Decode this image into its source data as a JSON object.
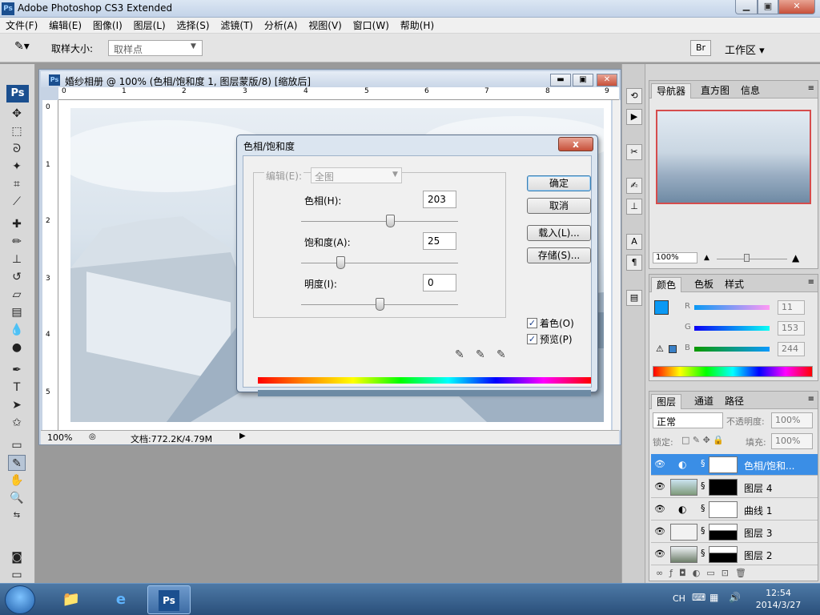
{
  "window": {
    "title": "Adobe Photoshop CS3 Extended",
    "app_icon": "Ps"
  },
  "menu": [
    "文件(F)",
    "编辑(E)",
    "图像(I)",
    "图层(L)",
    "选择(S)",
    "滤镜(T)",
    "分析(A)",
    "视图(V)",
    "窗口(W)",
    "帮助(H)"
  ],
  "options": {
    "sample_label": "取样大小:",
    "sample_value": "取样点",
    "workspace": "工作区 ▾",
    "bridge": "Br"
  },
  "toolbox": {
    "logo": "Ps"
  },
  "document": {
    "title": "婚纱相册 @ 100% (色相/饱和度 1, 图层蒙版/8) [缩放后]",
    "ruler_top": [
      "0",
      "1",
      "2",
      "3",
      "4",
      "5",
      "6",
      "7",
      "8",
      "9"
    ],
    "ruler_left": [
      "0",
      "1",
      "2",
      "3",
      "4",
      "5"
    ],
    "zoom": "100%",
    "status": "文档:772.2K/4.79M"
  },
  "dialog": {
    "title": "色相/饱和度",
    "close": "x",
    "edit_label": "编辑(E):",
    "edit_value": "全图",
    "hue_label": "色相(H):",
    "hue_value": "203",
    "sat_label": "饱和度(A):",
    "sat_value": "25",
    "light_label": "明度(I):",
    "light_value": "0",
    "ok": "确定",
    "cancel": "取消",
    "load": "载入(L)...",
    "save": "存储(S)...",
    "colorize": "着色(O)",
    "preview": "预览(P)",
    "colorize_checked": true,
    "preview_checked": true,
    "hue_level": 0.565,
    "sat_level": 0.25,
    "light_level": 0.5
  },
  "navigator": {
    "tabs": [
      "导航器",
      "直方图",
      "信息"
    ],
    "zoom": "100%"
  },
  "color_panel": {
    "tabs": [
      "颜色",
      "色板",
      "样式"
    ],
    "r_label": "R",
    "g_label": "G",
    "b_label": "B",
    "r": "11",
    "g": "153",
    "b": "244",
    "fg_color": "#0b99f4"
  },
  "layers_panel": {
    "tabs": [
      "图层",
      "通道",
      "路径"
    ],
    "blend": "正常",
    "opacity_label": "不透明度:",
    "opacity": "100%",
    "lock_label": "锁定:",
    "fill_label": "填充:",
    "fill": "100%",
    "layers": [
      {
        "name": "色相/饱和...",
        "selected": true
      },
      {
        "name": "图层 4",
        "selected": false
      },
      {
        "name": "曲线 1",
        "selected": false
      },
      {
        "name": "图层 3",
        "selected": false
      },
      {
        "name": "图层 2",
        "selected": false
      }
    ]
  },
  "taskbar": {
    "lang": "CH",
    "time": "12:54",
    "date": "2014/3/27",
    "ps_label": "Ps"
  }
}
